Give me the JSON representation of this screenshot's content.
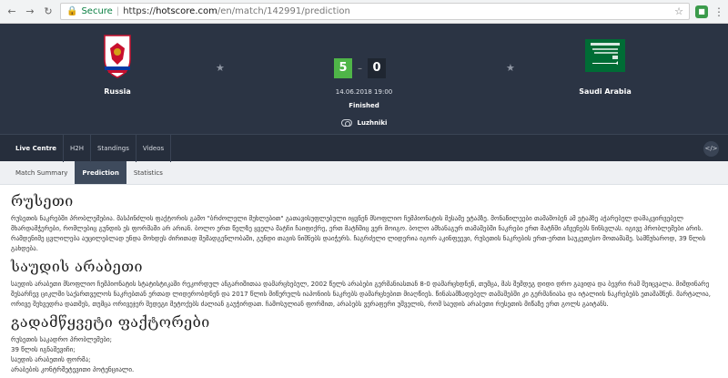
{
  "browser": {
    "secure_label": "Secure",
    "url_scheme": "https://",
    "url_host": "hotscore.com",
    "url_path": "/en/match/142991/prediction"
  },
  "match": {
    "home_team": "Russia",
    "away_team": "Saudi Arabia",
    "home_score": "5",
    "away_score": "0",
    "score_separator": "–",
    "date": "14.06.2018 19:00",
    "status": "Finished",
    "venue": "Luzhniki"
  },
  "main_tabs": [
    {
      "label": "Live Centre"
    },
    {
      "label": "H2H"
    },
    {
      "label": "Standings"
    },
    {
      "label": "Videos"
    }
  ],
  "sub_tabs": [
    {
      "label": "Match Summary"
    },
    {
      "label": "Prediction"
    },
    {
      "label": "Statistics"
    }
  ],
  "prediction": {
    "russia_heading": "რუსეთი",
    "russia_text": "რუსეთის ნაკრებში პრობლემებია. მასპინძლის ფაქტორის გამო \"ბრძოლელი მუხლებით\" გათავისუფლებული იყვნენ მსოფლიო ჩემპიონატის მესამე ეტაპზე. მონაწილეები თამაშობენ ამ ეტაპზე აჭარებულ დამაკვირვებელ მხარდამჭერები, რომლებიც გუნდის ეს ფორმაში არ არიან. ბოლო ერთ წელზე ყველა მატჩი ჩაიფიქრე, ერთ მატჩშიც ვერ მოიგო. ბოლო ამხანაგურ თამაშებში ნაკრები ერთ მატჩში აჩვენებს წინსვლას. იგივე პრობლემები არის. რამდენიმე ცვლილება აუცილებლად უნდა მოხდეს ძირითად შემადგენლობაში, გუნდი თავის ნიშნებს დაიჭერს. ჩაგრძელი ლიდერია იგორ აკინფეევი, რუსეთის ნაკრების ერთ-ერთი საუკეთესო მოთამაშე. სამწუხაროდ, 39 წლის გახდება.",
    "saudi_heading": "საუდის არაბეთი",
    "saudi_text": "საუდის არაბეთი მსოფლიო ჩემპიონატის სტატისტიკაში რეკორდულ ანგარიშითაა დამარცხებულ, 2002 წელს არაბები გერმანიასთან 8-0 დამარცხდნენ, თუმცა, მას შემდეგ დიდი დრო გავიდა და ბევრი რამ შეიცვალა. მიმდინარე შესარჩევ ციკლში საქართველოს ნაკრებთან ერთად ლიდერობდნენ და 2017 წლის მიწურულს იაპონიის ნაკრებს დამარცხებით მიაღწიეს. წინასამზადებელ თამაშებში კი გერმანიასა და იტალიის ნაკრებებს ეთამაშნენ. მარტალია, ორივე შეხვედრა დათმეს, თუმცა ორივეჯერ შედეგი მეტოქებს ძალიან გაუჭირდათ. ჩამოსულიან ფორმით, არაბებს ვერაფერი უშველის, რომ საუდის არაბეთი რუსეთის მიწაზე ერთ გოლს გაიტანს.",
    "factors_heading": "გადამწყვეტი ფაქტორები",
    "factors": [
      "რუსეთის საკადრო პრობლემები;",
      "39 წლის იგნაშევიჩი;",
      "საუდის არაბეთის ფორმა;",
      "არაბების კონტრშეტევითი პოტენციალი."
    ]
  }
}
